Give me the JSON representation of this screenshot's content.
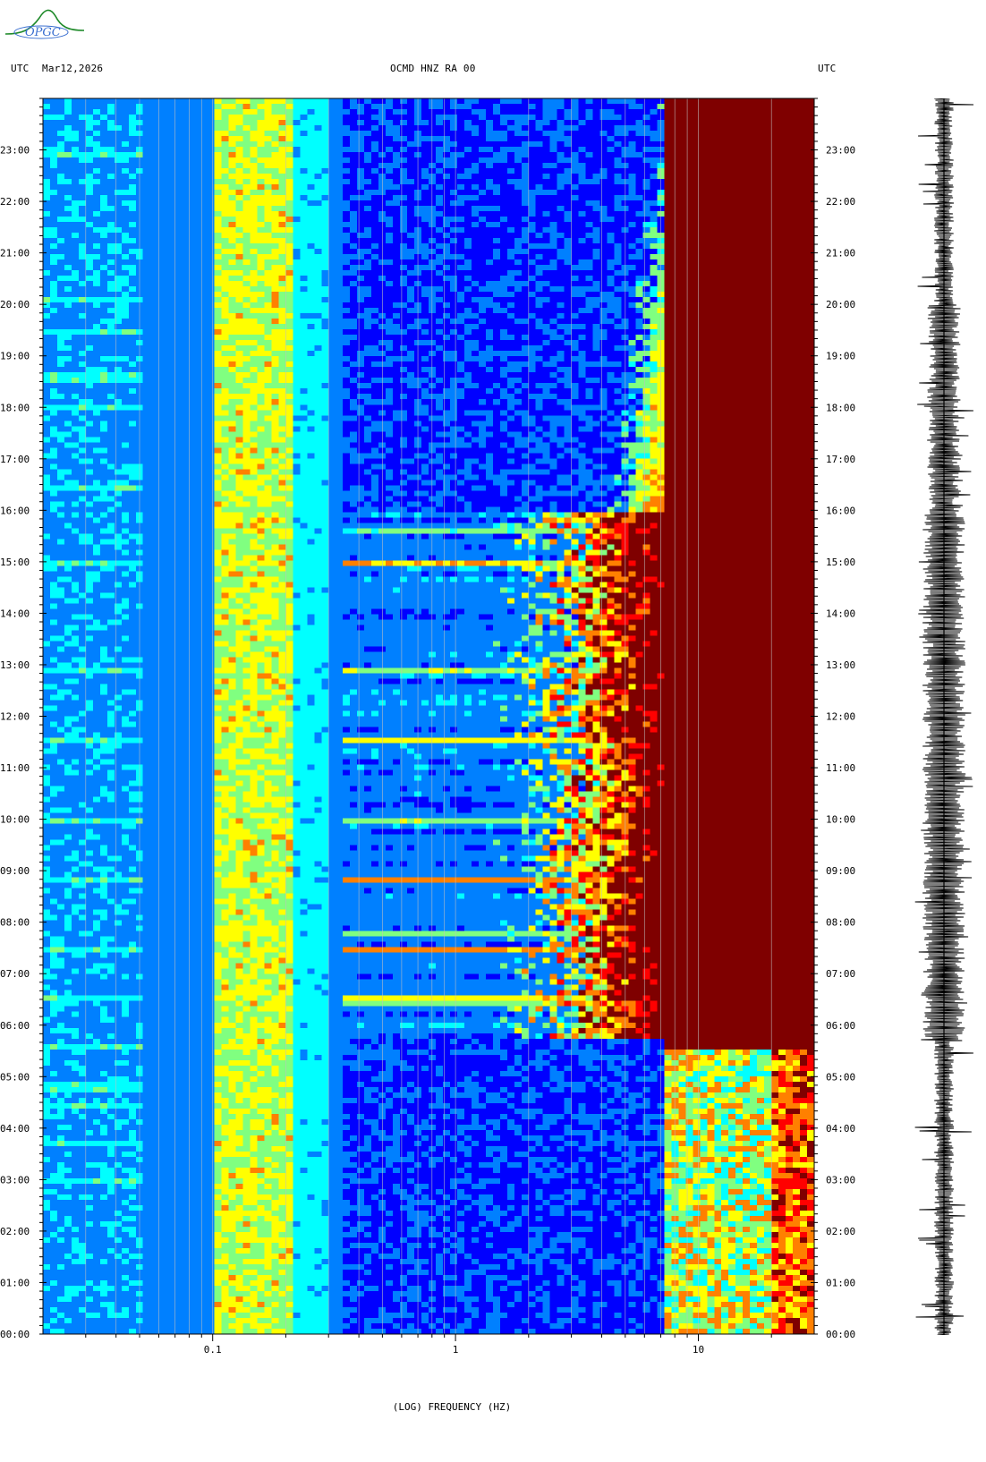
{
  "header": {
    "left_tz": "UTC",
    "date": "Mar12,2026",
    "station": "OCMD HNZ RA 00",
    "right_tz": "UTC"
  },
  "logo": {
    "text": "OPGC",
    "color": "#1f8a2a"
  },
  "chart_data": {
    "type": "heatmap",
    "title": "OCMD HNZ RA 00",
    "xlabel": "(LOG) FREQUENCY (HZ)",
    "ylabel": "",
    "x_scale": "log",
    "xlim": [
      0.02,
      30
    ],
    "x_ticks": [
      {
        "value": 0.1,
        "label": "0.1"
      },
      {
        "value": 1,
        "label": "1"
      },
      {
        "value": 10,
        "label": "10"
      }
    ],
    "ylim_hours": [
      0,
      24
    ],
    "y_ticks": [
      "00:00",
      "01:00",
      "02:00",
      "03:00",
      "04:00",
      "05:00",
      "06:00",
      "07:00",
      "08:00",
      "09:00",
      "10:00",
      "11:00",
      "12:00",
      "13:00",
      "14:00",
      "15:00",
      "16:00",
      "17:00",
      "18:00",
      "19:00",
      "20:00",
      "21:00",
      "22:00",
      "23:00"
    ],
    "colormap": [
      "#00007f",
      "#0000ff",
      "#0080ff",
      "#00ffff",
      "#80ff80",
      "#ffff00",
      "#ff8000",
      "#ff0000",
      "#7f0000"
    ],
    "features": {
      "microseism_band_hz": [
        0.12,
        0.18
      ],
      "daytime_cultural_noise_hours": [
        5.7,
        16.0
      ],
      "daytime_noise_lowest_hz": 1.2,
      "tonal_line_hz": 12.5,
      "tonal_line_hours": [
        0,
        4.5
      ]
    }
  }
}
